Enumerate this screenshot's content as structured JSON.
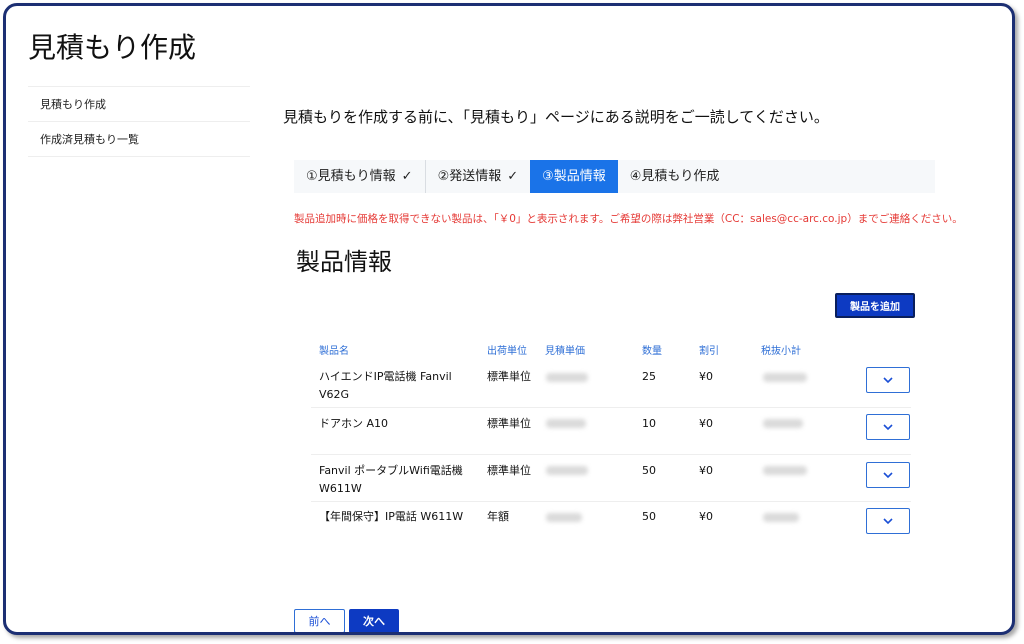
{
  "page": {
    "title": "見積もり作成"
  },
  "sidebar": {
    "items": [
      {
        "label": "見積もり作成"
      },
      {
        "label": "作成済見積もり一覧"
      }
    ]
  },
  "intro": "見積もりを作成する前に、「見積もり」ページにある説明をご一読してください。",
  "steps": [
    {
      "label": "①見積もり情報",
      "done": true
    },
    {
      "label": "②発送情報",
      "done": true
    },
    {
      "label": "③製品情報",
      "active": true
    },
    {
      "label": "④見積もり作成"
    }
  ],
  "check_glyph": "✓",
  "notice": "製品追加時に価格を取得できない製品は、「￥0」と表示されます。ご希望の際は弊社営業（CC：sales@cc-arc.co.jp）までご連絡ください。",
  "section_title": "製品情報",
  "add_button_label": "製品を追加",
  "table": {
    "headers": [
      "製品名",
      "出荷単位",
      "見積単価",
      "数量",
      "割引",
      "税抜小計"
    ],
    "rows": [
      {
        "name": "ハイエンドIP電話機 Fanvil V62G",
        "unit": "標準単位",
        "qty": "25",
        "discount": "¥0"
      },
      {
        "name": "ドアホン A10",
        "unit": "標準単位",
        "qty": "10",
        "discount": "¥0"
      },
      {
        "name": "Fanvil ポータブルWifi電話機 W611W",
        "unit": "標準単位",
        "qty": "50",
        "discount": "¥0"
      },
      {
        "name": "【年間保守】IP電話 W611W",
        "unit": "年額",
        "qty": "50",
        "discount": "¥0"
      }
    ]
  },
  "nav": {
    "prev_label": "前へ",
    "next_label": "次へ"
  },
  "colors": {
    "accent": "#1a73e8",
    "primary_button": "#0d3ac2",
    "notice": "#e53935",
    "frame": "#1c2f73"
  },
  "icons": {
    "row_toggle": "chevron-down-icon",
    "step_done": "check-icon"
  }
}
